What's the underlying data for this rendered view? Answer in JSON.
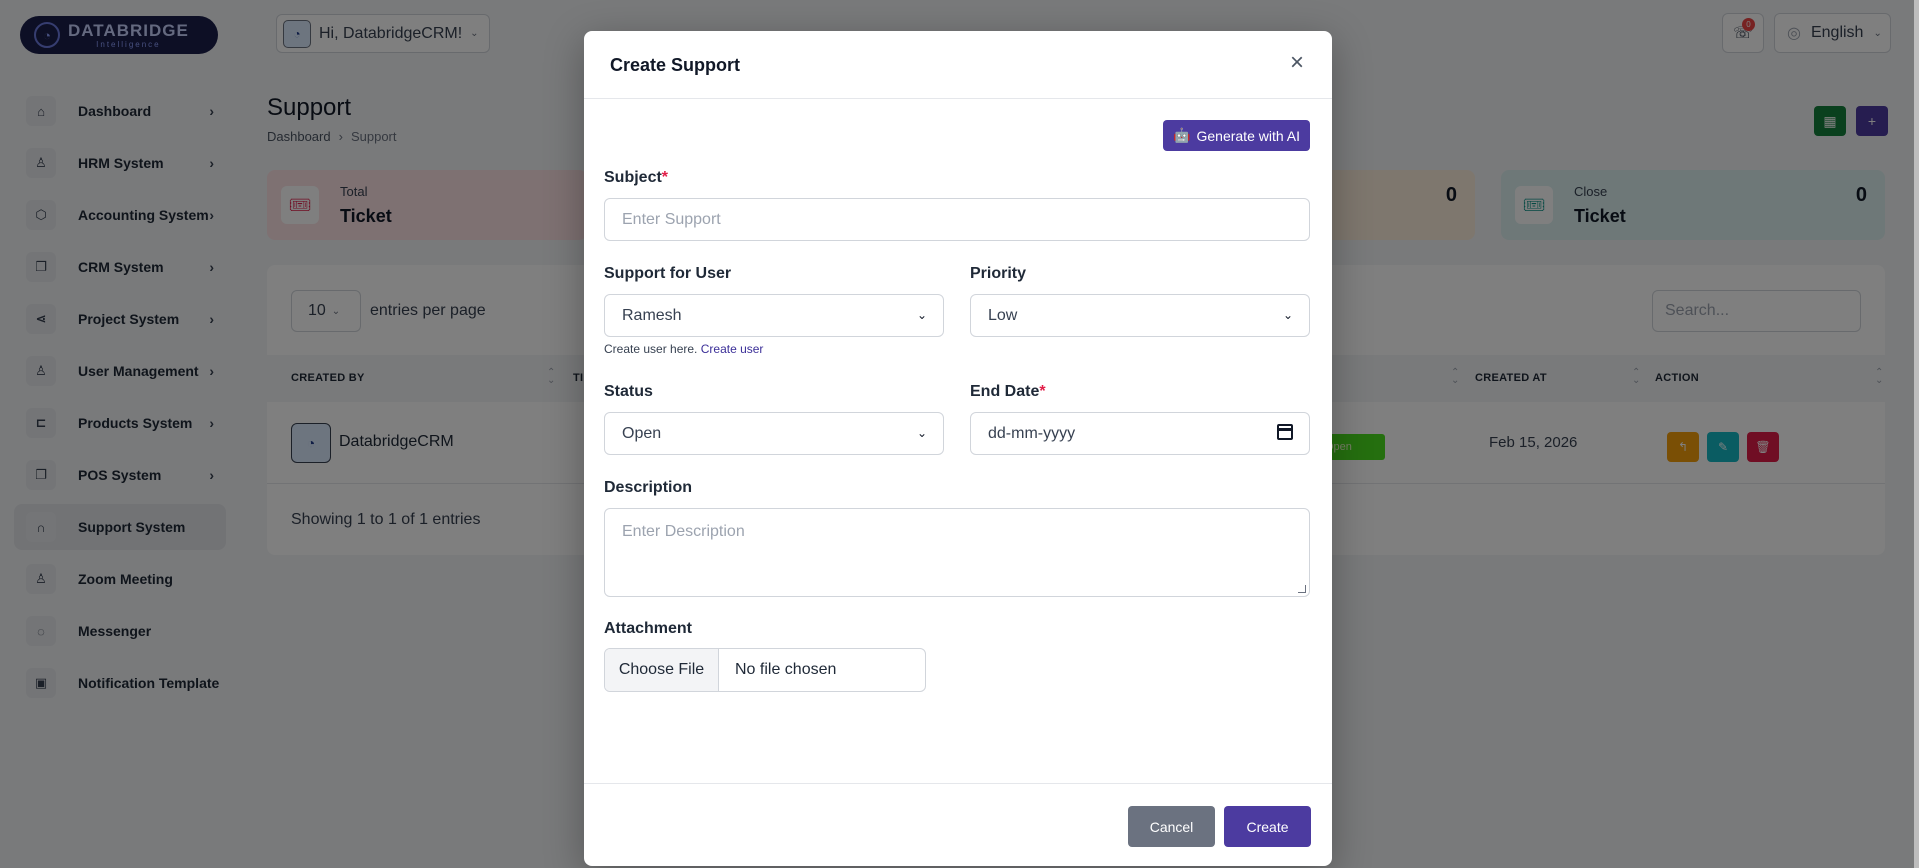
{
  "brand": {
    "name": "DATABRIDGE",
    "tagline": "Intelligence"
  },
  "header": {
    "greeting": "Hi, DatabridgeCRM!",
    "notification_count": "0",
    "language": "English"
  },
  "sidebar": {
    "items": [
      {
        "label": "Dashboard",
        "icon": "home-icon"
      },
      {
        "label": "HRM System",
        "icon": "user-icon"
      },
      {
        "label": "Accounting System",
        "icon": "box-icon"
      },
      {
        "label": "CRM System",
        "icon": "layers-icon"
      },
      {
        "label": "Project System",
        "icon": "share-icon"
      },
      {
        "label": "User Management",
        "icon": "users-icon"
      },
      {
        "label": "Products System",
        "icon": "cart-icon"
      },
      {
        "label": "POS System",
        "icon": "layers-icon"
      },
      {
        "label": "Support System",
        "icon": "headphones-icon"
      },
      {
        "label": "Zoom Meeting",
        "icon": "user-check-icon"
      },
      {
        "label": "Messenger",
        "icon": "message-icon"
      },
      {
        "label": "Notification Template",
        "icon": "bell-file-icon"
      }
    ]
  },
  "page": {
    "title": "Support",
    "breadcrumb": [
      "Dashboard",
      "Support"
    ]
  },
  "stats": {
    "total": {
      "label": "Total",
      "value": "Ticket"
    },
    "orange": {
      "count": "0"
    },
    "close": {
      "label": "Close",
      "value": "Ticket",
      "count": "0"
    }
  },
  "table": {
    "per_page": "10",
    "per_page_label": "entries per page",
    "search_placeholder": "Search...",
    "headers": [
      "CREATED BY",
      "TI",
      "CREATED AT",
      "ACTION"
    ],
    "rows": [
      {
        "created_by": "DatabridgeCRM",
        "status": "Open",
        "created_at": "Feb 15, 2026"
      }
    ],
    "showing": "Showing 1 to 1 of 1 entries"
  },
  "modal": {
    "title": "Create Support",
    "ai_button": "Generate with AI",
    "subject": {
      "label": "Subject",
      "placeholder": "Enter Support"
    },
    "support_user": {
      "label": "Support for User",
      "value": "Ramesh"
    },
    "hint_text": "Create user here.",
    "hint_link": "Create user",
    "priority": {
      "label": "Priority",
      "value": "Low"
    },
    "status": {
      "label": "Status",
      "value": "Open"
    },
    "end_date": {
      "label": "End Date",
      "placeholder": "dd-mm-yyyy"
    },
    "description": {
      "label": "Description",
      "placeholder": "Enter Description"
    },
    "attachment": {
      "label": "Attachment",
      "button": "Choose File",
      "status": "No file chosen"
    },
    "cancel": "Cancel",
    "create": "Create"
  }
}
